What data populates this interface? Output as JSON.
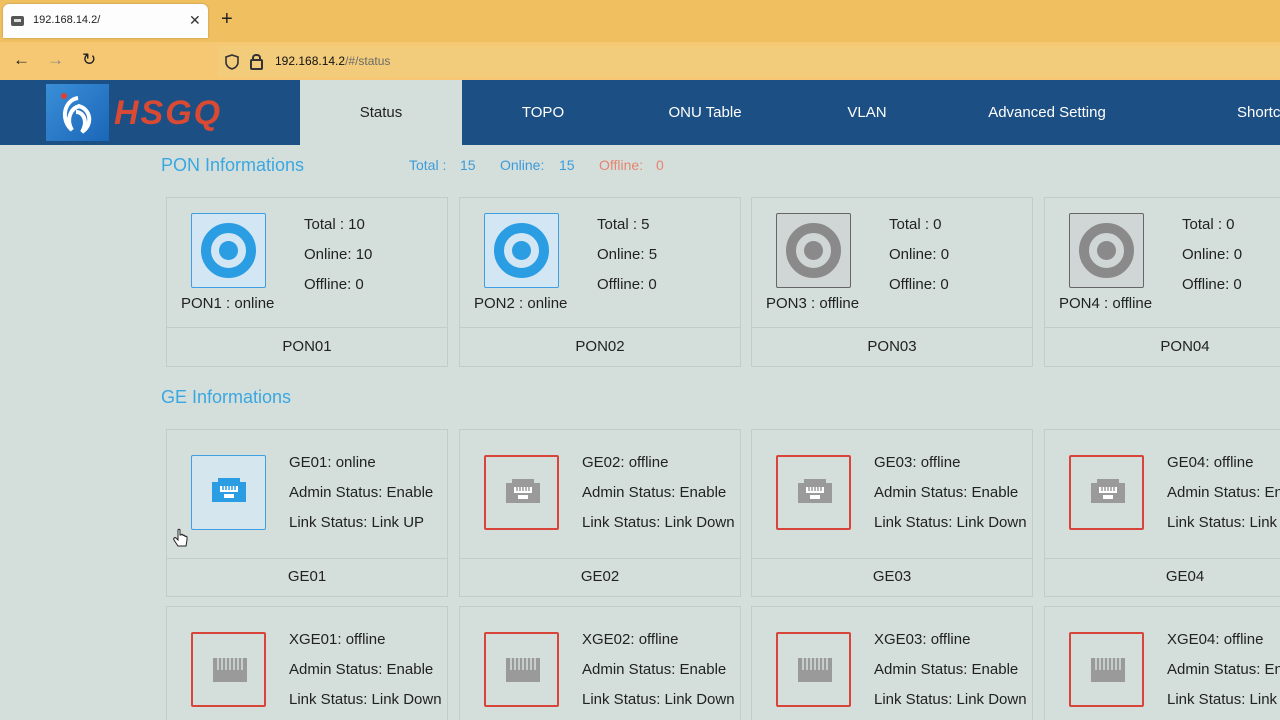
{
  "browser": {
    "tab_title": "192.168.14.2/",
    "tab_close": "✕",
    "new_tab": "+",
    "back": "←",
    "forward": "→",
    "reload": "↻",
    "url_host": "192.168.14.2",
    "url_path": "/#/status"
  },
  "header": {
    "logo_text": "HSGQ",
    "menu": [
      "Status",
      "TOPO",
      "ONU Table",
      "VLAN",
      "Advanced Setting",
      "Shortc"
    ],
    "active_menu": "Status"
  },
  "pon": {
    "title": "PON Informations",
    "total_label": "Total :",
    "total_value": "15",
    "online_label": "Online:",
    "online_value": "15",
    "offline_label": "Offline:",
    "offline_value": "0",
    "cards": [
      {
        "total": "Total : 10",
        "online": "Online: 10",
        "offline": "Offline: 0",
        "caption": "PON1 : online",
        "footer": "PON01",
        "state": "online"
      },
      {
        "total": "Total : 5",
        "online": "Online: 5",
        "offline": "Offline: 0",
        "caption": "PON2 : online",
        "footer": "PON02",
        "state": "online"
      },
      {
        "total": "Total : 0",
        "online": "Online: 0",
        "offline": "Offline: 0",
        "caption": "PON3 : offline",
        "footer": "PON03",
        "state": "offline"
      },
      {
        "total": "Total : 0",
        "online": "Online: 0",
        "offline": "Offline: 0",
        "caption": "PON4 : offline",
        "footer": "PON04",
        "state": "offline"
      }
    ]
  },
  "ge": {
    "title": "GE Informations",
    "cards": [
      {
        "status": "GE01: online",
        "admin": "Admin Status: Enable",
        "link": "Link Status: Link UP",
        "footer": "GE01",
        "state": "online"
      },
      {
        "status": "GE02: offline",
        "admin": "Admin Status: Enable",
        "link": "Link Status: Link Down",
        "footer": "GE02",
        "state": "offline"
      },
      {
        "status": "GE03: offline",
        "admin": "Admin Status: Enable",
        "link": "Link Status: Link Down",
        "footer": "GE03",
        "state": "offline"
      },
      {
        "status": "GE04: offline",
        "admin": "Admin Status: En",
        "link": "Link Status: Link",
        "footer": "GE04",
        "state": "offline"
      }
    ]
  },
  "xge": {
    "cards": [
      {
        "status": "XGE01: offline",
        "admin": "Admin Status: Enable",
        "link": "Link Status: Link Down",
        "state": "offline"
      },
      {
        "status": "XGE02: offline",
        "admin": "Admin Status: Enable",
        "link": "Link Status: Link Down",
        "state": "offline"
      },
      {
        "status": "XGE03: offline",
        "admin": "Admin Status: Enable",
        "link": "Link Status: Link Down",
        "state": "offline"
      },
      {
        "status": "XGE04: offline",
        "admin": "Admin Status: En",
        "link": "Link Status: Link",
        "state": "offline"
      }
    ]
  },
  "colors": {
    "header_bg": "#1c4f83",
    "accent_blue": "#3aa7e0",
    "offline_red": "#d8443a",
    "page_bg": "#d4dfdc"
  }
}
